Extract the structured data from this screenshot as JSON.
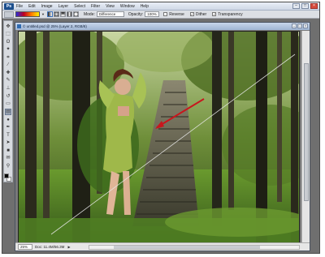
{
  "app": {
    "logo_text": "Ps"
  },
  "menu": {
    "items": [
      "File",
      "Edit",
      "Image",
      "Layer",
      "Select",
      "Filter",
      "View",
      "Window",
      "Help"
    ]
  },
  "window_controls": {
    "minimize": "–",
    "maximize": "□",
    "close": "×"
  },
  "options_bar": {
    "mode_label": "Mode:",
    "mode_value": "Difference",
    "opacity_label": "Opacity:",
    "opacity_value": "100%",
    "reverse_label": "Reverse",
    "dither_label": "Dither",
    "transparency_label": "Transparency",
    "reverse_checked": false,
    "dither_checked": true,
    "transparency_checked": true,
    "gradient_colors": [
      "#2a2dd8",
      "#c00020",
      "#ff7a00",
      "#ffef00"
    ]
  },
  "toolbox": {
    "tools": [
      "move-tool",
      "marquee-tool",
      "lasso-tool",
      "magic-wand-tool",
      "crop-tool",
      "slice-tool",
      "healing-brush-tool",
      "brush-tool",
      "clone-stamp-tool",
      "history-brush-tool",
      "eraser-tool",
      "gradient-tool",
      "dodge-tool",
      "pen-tool",
      "type-tool",
      "path-selection-tool",
      "shape-tool",
      "notes-tool",
      "eyedropper-tool",
      "hand-tool",
      "zoom-tool"
    ],
    "active_tool": "gradient-tool",
    "foreground_color": "#000000",
    "background_color": "#ffffff"
  },
  "document": {
    "title": "© untitled.psd @ 25% (Layer 2, RGB/8)",
    "zoom": "25%",
    "doc_info": "Doc: 11.4M/56.3M"
  },
  "canvas": {
    "gradient_drag_arrow_color": "#c8161d",
    "guide_line_color": "#e8e8e8"
  }
}
